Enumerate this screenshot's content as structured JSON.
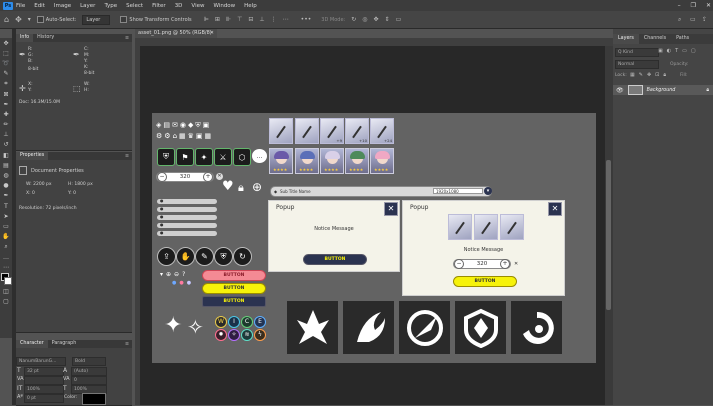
{
  "menu": {
    "logo": "Ps",
    "items": [
      "File",
      "Edit",
      "Image",
      "Layer",
      "Type",
      "Select",
      "Filter",
      "3D",
      "View",
      "Window",
      "Help"
    ],
    "window_controls": [
      "–",
      "❐",
      "✕"
    ]
  },
  "options": {
    "auto_select_label": "Auto-Select:",
    "auto_select_value": "Layer",
    "show_transform_label": "Show Transform Controls",
    "mode_3d_label": "3D Mode:",
    "more": "•••"
  },
  "info_panel": {
    "tabs": [
      "Info",
      "History"
    ],
    "r_label": "R:",
    "g_label": "G:",
    "b_label": "B:",
    "c_label": "C:",
    "m_label": "M:",
    "y_label": "Y:",
    "k_label": "K:",
    "bit1": "8-bit",
    "bit2": "8-bit",
    "x_label": "X:",
    "y2_label": "Y:",
    "w_label": "W:",
    "h_label": "H:",
    "doc": "Doc: 16.3M/15.0M"
  },
  "properties_panel": {
    "title": "Properties",
    "doc_props": "Document Properties",
    "w": "W:  2200 px",
    "h": "H:  1800 px",
    "x": "X:  0",
    "y": "Y:  0",
    "resolution": "Resolution: 72 pixels/inch"
  },
  "character_panel": {
    "tabs": [
      "Character",
      "Paragraph"
    ],
    "font": "NanumBarunG...",
    "weight": "Bold",
    "size": "32 pt",
    "leading": "(Auto)",
    "tracking": "0",
    "scale_v": "100%",
    "scale_h": "100%",
    "baseline": "0 pt",
    "color_label": "Color:"
  },
  "document": {
    "tab": "asset_01.png @ 50% (RGB/8)"
  },
  "layers_panel": {
    "tabs": [
      "Layers",
      "Channels",
      "Paths"
    ],
    "kind": "Q Kind",
    "blend": "Normal",
    "opacity": "Opacity:",
    "lock": "Lock:",
    "fill": "Fill:",
    "layer_name": "Background"
  },
  "asset": {
    "stepper_value": "320",
    "subtitle_label": "Sub Title Name",
    "res_dropdown": "1920x1080",
    "card_levels": [
      "+9",
      "+10",
      "+20",
      "+24"
    ],
    "button_label": "BUTTON",
    "popup_title": "Popup",
    "notice": "Notice Message",
    "tools_letters": [
      "W",
      "I",
      "C",
      "E"
    ],
    "colors": {
      "pink_button": "#f48a94",
      "yellow_button": "#f6f20a",
      "navy_button": "#2b3350",
      "popup_bg": "#f4f3e9",
      "canvas_bg": "#636363"
    }
  }
}
